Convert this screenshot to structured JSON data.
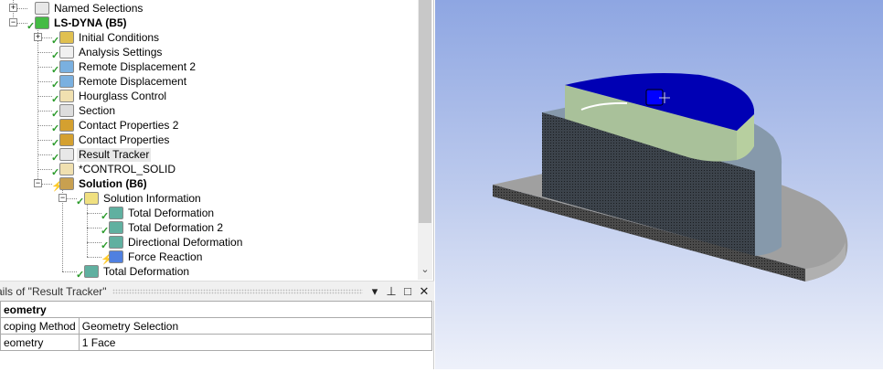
{
  "tree": {
    "items": [
      {
        "label": "Named Selections",
        "status": "none",
        "icon": "named-selection-icon"
      },
      {
        "label": "LS-DYNA (B5)",
        "status": "check",
        "icon": "ls-dyna-icon"
      },
      {
        "label": "Initial Conditions",
        "status": "check",
        "icon": "initial-conditions-icon"
      },
      {
        "label": "Analysis Settings",
        "status": "check",
        "icon": "analysis-settings-icon"
      },
      {
        "label": "Remote Displacement 2",
        "status": "check",
        "icon": "remote-displacement-icon"
      },
      {
        "label": "Remote Displacement",
        "status": "check",
        "icon": "remote-displacement-icon"
      },
      {
        "label": "Hourglass Control",
        "status": "check",
        "icon": "hourglass-icon"
      },
      {
        "label": "Section",
        "status": "check",
        "icon": "section-icon"
      },
      {
        "label": "Contact Properties 2",
        "status": "check",
        "icon": "contact-properties-icon"
      },
      {
        "label": "Contact Properties",
        "status": "check",
        "icon": "contact-properties-icon"
      },
      {
        "label": "Result Tracker",
        "status": "check",
        "icon": "result-tracker-icon"
      },
      {
        "label": "*CONTROL_SOLID",
        "status": "check",
        "icon": "keyword-icon"
      },
      {
        "label": "Solution (B6)",
        "status": "bolt",
        "icon": "solution-icon"
      },
      {
        "label": "Solution Information",
        "status": "check",
        "icon": "solution-information-icon"
      },
      {
        "label": "Total Deformation",
        "status": "check",
        "icon": "result-icon"
      },
      {
        "label": "Total Deformation 2",
        "status": "check",
        "icon": "result-icon"
      },
      {
        "label": "Directional Deformation",
        "status": "check",
        "icon": "result-icon"
      },
      {
        "label": "Force Reaction",
        "status": "bolt",
        "icon": "probe-icon"
      },
      {
        "label": "Total Deformation",
        "status": "check",
        "icon": "result-icon"
      }
    ]
  },
  "details": {
    "title": "ails of \"Result Tracker\"",
    "rows": [
      {
        "group": "eometry"
      },
      {
        "key": "coping Method",
        "value": "Geometry Selection"
      },
      {
        "key": "eometry",
        "value": "1 Face"
      }
    ]
  },
  "colors": {
    "selected_face": "#0000b4",
    "viewport_top": "#8ea6e2",
    "viewport_bottom": "#eef1fa"
  }
}
